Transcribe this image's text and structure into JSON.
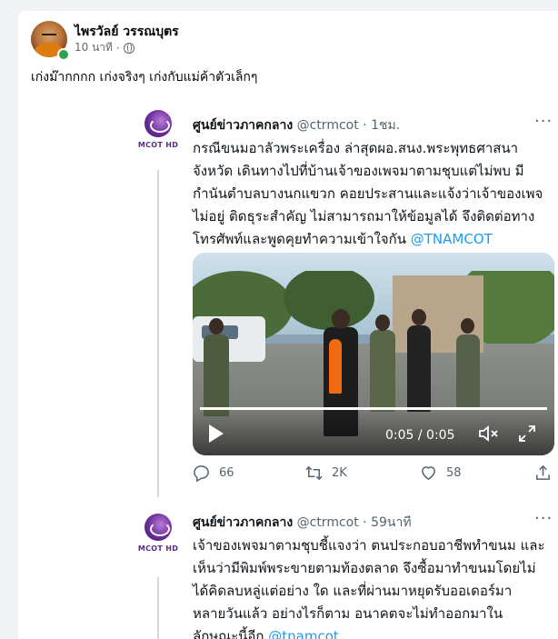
{
  "post": {
    "author": "ไพรวัลย์ วรรณบุตร",
    "time": "10 นาที",
    "time_sep": "·",
    "text": "เก่งม๊ากกกก เก่งจริงๆ เก่งกับแม่ค้าตัวเล็กๆ"
  },
  "tweets": [
    {
      "logo_text": "MCOT HD",
      "name": "ศูนย์ข่าวภาคกลาง",
      "handle": "@ctrmcot",
      "time": "· 1ชม.",
      "more": "···",
      "body": "กรณีขนมอาลัวพระเครื่อง ล่าสุดผอ.สนง.พระพุทธศาสนา\nจังหวัด เดินทางไปที่บ้านเจ้าของเพจมาตามชุบแต่ไม่พบ มี\nกำนันตำบลบางนกแขวก คอยประสานและแจ้งว่าเจ้าของเพจ\nไม่อยู่ ติดธุระสำคัญ ไม่สามารถมาให้ข้อมูลได้ จึงติดต่อทาง\nโทรศัพท์และพูดคุยทำความเข้าใจกัน ",
      "mention": "@TNAMCOT",
      "video_time": "0:05 / 0:05",
      "reply_count": "66",
      "retweet_count": "2K",
      "like_count": "58"
    },
    {
      "logo_text": "MCOT HD",
      "name": "ศูนย์ข่าวภาคกลาง",
      "handle": "@ctrmcot",
      "time": "· 59นาที",
      "more": "···",
      "body": "เจ้าของเพจมาตามชุบชี้แจงว่า ตนประกอบอาชีพทำขนม และ\nเห็นว่ามีพิมพ์พระขายตามท้องตลาด จึงซื้อมาทำขนมโดยไม่\nได้คิดลบหลู่แต่อย่าง ใด และที่ผ่านมาหยุดรับออเดอร์มา\nหลายวันแล้ว อย่างไรก็ตาม อนาคตจะไม่ทำออกมาใน\nลักษณะนี้อีก ",
      "mention": "@tnamcot"
    }
  ],
  "colors": {
    "link": "#1d9bf0",
    "online": "#31a24c",
    "mcot_purple": "#6b2e9a"
  }
}
